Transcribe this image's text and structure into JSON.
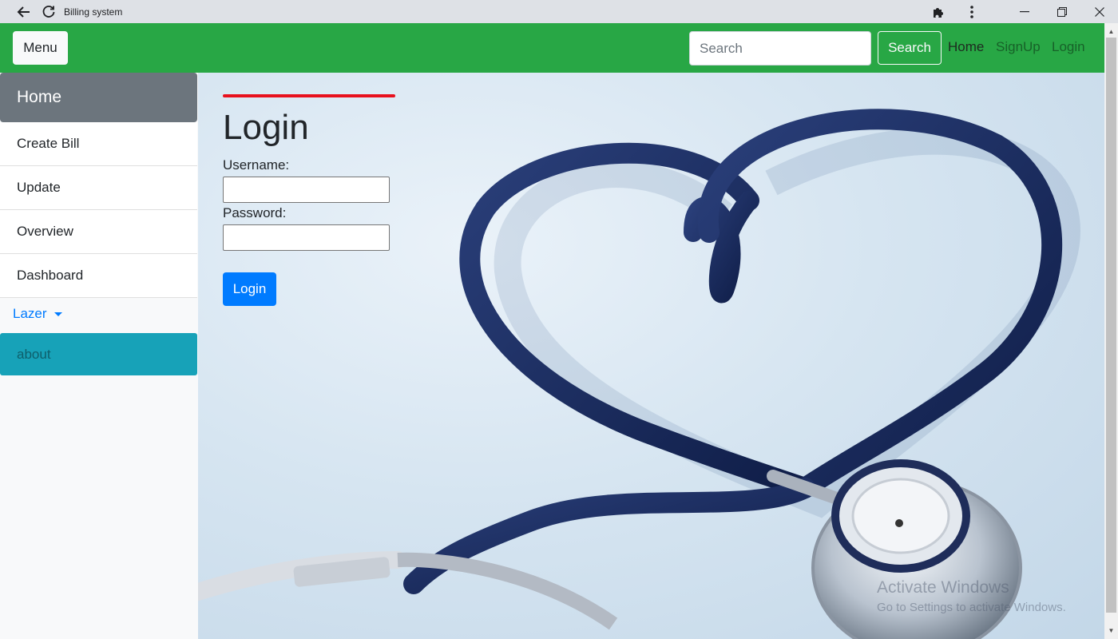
{
  "browser": {
    "tab_title": "Billing system"
  },
  "navbar": {
    "menu_label": "Menu",
    "search_placeholder": "Search",
    "search_button": "Search",
    "links": [
      "Home",
      "SignUp",
      "Login"
    ],
    "background_color": "#28a745"
  },
  "sidebar": {
    "active_item": "Home",
    "items": [
      "Create Bill",
      "Update",
      "Overview",
      "Dashboard"
    ],
    "dropdown_label": "Lazer",
    "about_label": "about"
  },
  "login": {
    "title": "Login",
    "username_label": "Username:",
    "password_label": "Password:",
    "username_value": "",
    "password_value": "",
    "submit_label": "Login"
  },
  "watermark": {
    "line1": "Activate Windows",
    "line2": "Go to Settings to activate Windows."
  },
  "colors": {
    "accent_bar": "#e8101d",
    "primary": "#007bff",
    "about_bg": "#17a2b8",
    "home_bg": "#6c757d"
  }
}
